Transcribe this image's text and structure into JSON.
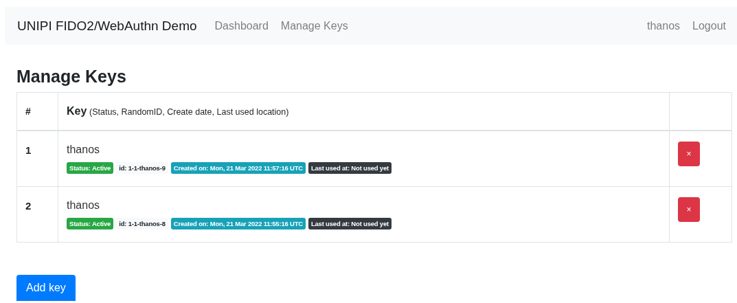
{
  "navbar": {
    "brand": "UNIPI FIDO2/WebAuthn Demo",
    "links": [
      "Dashboard",
      "Manage Keys"
    ],
    "user": "thanos",
    "logout": "Logout"
  },
  "heading": "Manage Keys",
  "table": {
    "columns": [
      {
        "label": "#"
      },
      {
        "label": "Key",
        "note": "(Status, RandomID, Create date, Last used location)"
      }
    ],
    "rows": [
      {
        "index": "1",
        "name": "thanos",
        "badges": [
          {
            "kind": "success",
            "text": "Status: Active"
          },
          {
            "kind": "light",
            "text": "id: 1-1-thanos-9"
          },
          {
            "kind": "info",
            "text": "Created on: Mon, 21 Mar 2022 11:57:16 UTC"
          },
          {
            "kind": "dark",
            "text": "Last used at: Not used yet"
          }
        ],
        "delete": "×"
      },
      {
        "index": "2",
        "name": "thanos",
        "badges": [
          {
            "kind": "success",
            "text": "Status: Active"
          },
          {
            "kind": "light",
            "text": "id: 1-1-thanos-8"
          },
          {
            "kind": "info",
            "text": "Created on: Mon, 21 Mar 2022 11:55:16 UTC"
          },
          {
            "kind": "dark",
            "text": "Last used at: Not used yet"
          }
        ],
        "delete": "×"
      }
    ]
  },
  "add_button": "Add key"
}
